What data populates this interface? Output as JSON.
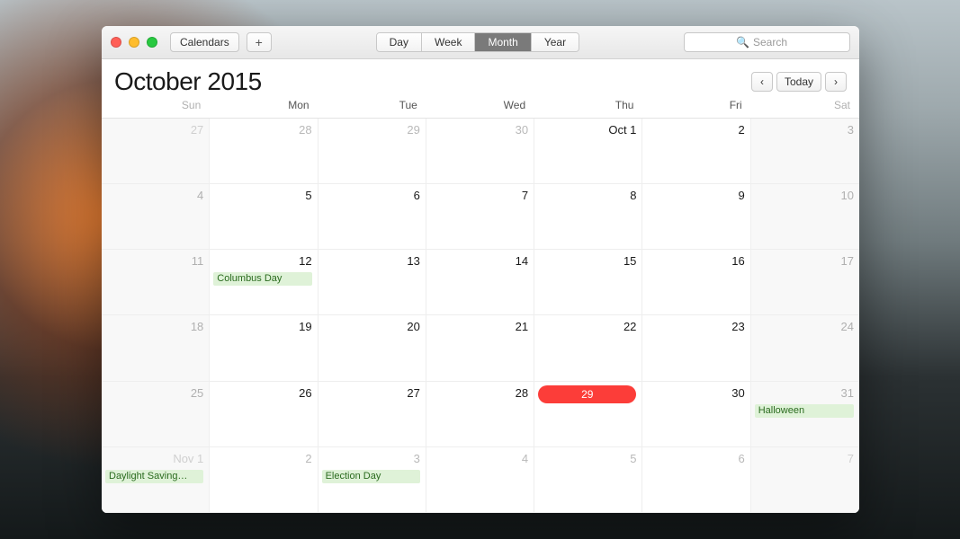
{
  "toolbar": {
    "calendars_label": "Calendars",
    "views": [
      "Day",
      "Week",
      "Month",
      "Year"
    ],
    "active_view": "Month",
    "search_placeholder": "Search"
  },
  "header": {
    "month": "October",
    "year": "2015",
    "today_label": "Today"
  },
  "weekdays": [
    "Sun",
    "Mon",
    "Tue",
    "Wed",
    "Thu",
    "Fri",
    "Sat"
  ],
  "grid": {
    "rows": 6,
    "cols": 7,
    "cells": [
      {
        "label": "27",
        "out": true,
        "weekend": true
      },
      {
        "label": "28",
        "out": true
      },
      {
        "label": "29",
        "out": true
      },
      {
        "label": "30",
        "out": true
      },
      {
        "label": "Oct 1"
      },
      {
        "label": "2"
      },
      {
        "label": "3",
        "weekend": true
      },
      {
        "label": "4",
        "weekend": true
      },
      {
        "label": "5"
      },
      {
        "label": "6"
      },
      {
        "label": "7"
      },
      {
        "label": "8"
      },
      {
        "label": "9"
      },
      {
        "label": "10",
        "weekend": true
      },
      {
        "label": "11",
        "weekend": true
      },
      {
        "label": "12",
        "events": [
          "Columbus Day"
        ]
      },
      {
        "label": "13"
      },
      {
        "label": "14"
      },
      {
        "label": "15"
      },
      {
        "label": "16"
      },
      {
        "label": "17",
        "weekend": true
      },
      {
        "label": "18",
        "weekend": true
      },
      {
        "label": "19"
      },
      {
        "label": "20"
      },
      {
        "label": "21"
      },
      {
        "label": "22"
      },
      {
        "label": "23"
      },
      {
        "label": "24",
        "weekend": true
      },
      {
        "label": "25",
        "weekend": true
      },
      {
        "label": "26"
      },
      {
        "label": "27"
      },
      {
        "label": "28"
      },
      {
        "label": "29",
        "today": true
      },
      {
        "label": "30"
      },
      {
        "label": "31",
        "weekend": true,
        "events": [
          "Halloween"
        ]
      },
      {
        "label": "Nov 1",
        "out": true,
        "weekend": true,
        "events": [
          "Daylight Saving…"
        ]
      },
      {
        "label": "2",
        "out": true
      },
      {
        "label": "3",
        "out": true,
        "events": [
          "Election Day"
        ]
      },
      {
        "label": "4",
        "out": true
      },
      {
        "label": "5",
        "out": true
      },
      {
        "label": "6",
        "out": true
      },
      {
        "label": "7",
        "out": true,
        "weekend": true
      }
    ]
  },
  "colors": {
    "today_badge": "#fc3d39",
    "event_bg": "#dff2d8",
    "event_fg": "#2a6b1e"
  }
}
